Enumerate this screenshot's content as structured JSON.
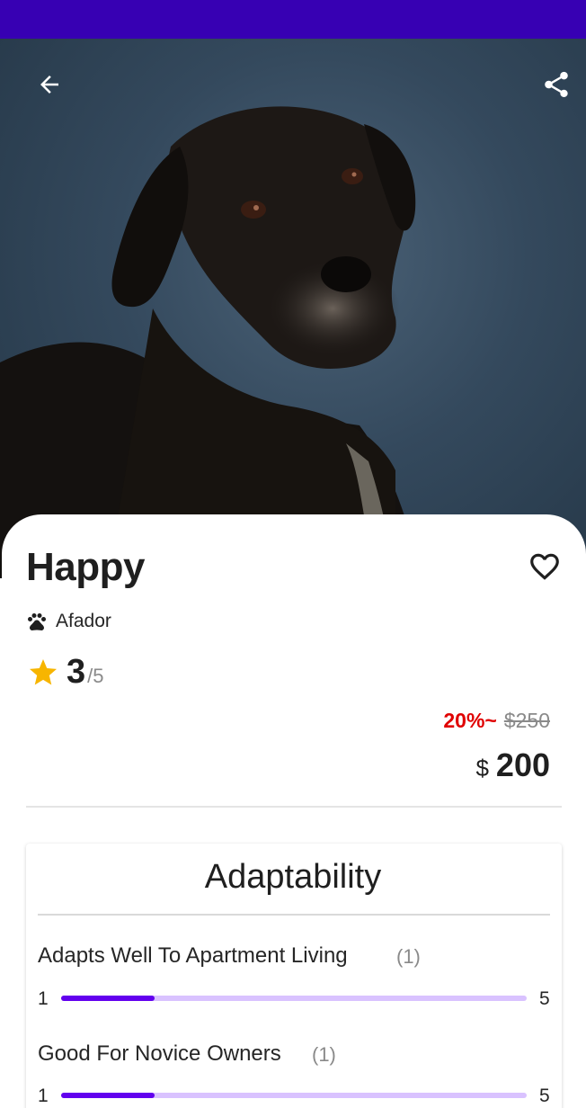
{
  "header": {
    "back_icon": "arrow-back-icon",
    "share_icon": "share-icon"
  },
  "colors": {
    "status_bar": "#3700b3",
    "accent": "#6200ee",
    "accent_light": "#d9c2ff",
    "discount": "#e00000",
    "star": "#f7b500"
  },
  "pet": {
    "name": "Happy",
    "breed_icon": "paw-icon",
    "breed": "Afador",
    "rating_icon": "star-icon",
    "rating": "3",
    "rating_max": "/5",
    "discount": "20%~",
    "old_price": "$250",
    "currency": "$",
    "price": "200",
    "favorite_icon": "heart-outline-icon"
  },
  "adaptability": {
    "title": "Adaptability",
    "traits": [
      {
        "label": "Adapts Well To Apartment Living",
        "count": "(1)",
        "min": "1",
        "max": "5",
        "level": 0.2
      },
      {
        "label": "Good For Novice Owners",
        "count": "(1)",
        "min": "1",
        "max": "5",
        "level": 0.2
      }
    ]
  }
}
